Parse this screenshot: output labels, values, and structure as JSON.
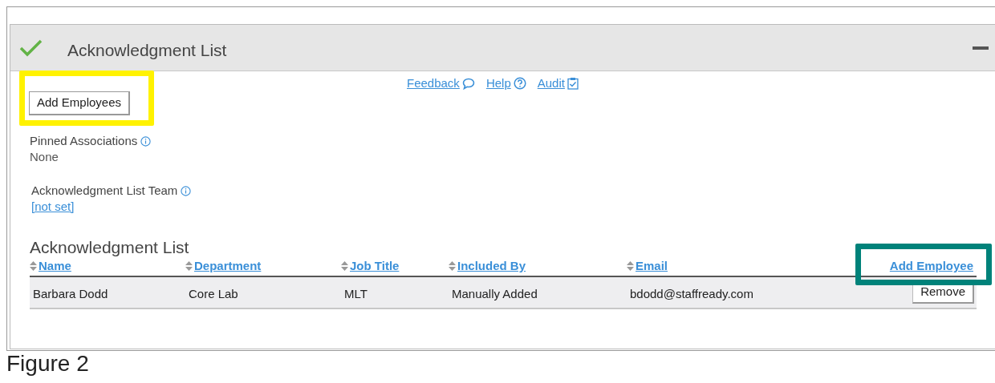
{
  "panel": {
    "title": "Acknowledgment List",
    "complete": true,
    "expanded": true
  },
  "links": [
    {
      "label": "Feedback"
    },
    {
      "label": "Help"
    },
    {
      "label": "Audit"
    }
  ],
  "add_employees_button": {
    "label": "Add Employees"
  },
  "fields": [
    {
      "label": "Pinned Associations",
      "value": "None",
      "kind": "text"
    },
    {
      "label": "Acknowledgment List Team",
      "value": "[not set]",
      "kind": "link"
    }
  ],
  "table": {
    "title": "Acknowledgment List",
    "columns": [
      "Name",
      "Department",
      "Job Title",
      "Included By",
      "Email"
    ],
    "add_link": {
      "label": "Add Employee"
    },
    "rows": [
      {
        "cells": [
          "Barbara Dodd",
          "Core Lab",
          "MLT",
          "Manually Added",
          "bdodd@staffready.com"
        ],
        "action": "Remove"
      }
    ]
  },
  "highlights": [
    {
      "color": "#fff200"
    },
    {
      "color": "#00827a"
    }
  ],
  "caption": "Figure 2"
}
